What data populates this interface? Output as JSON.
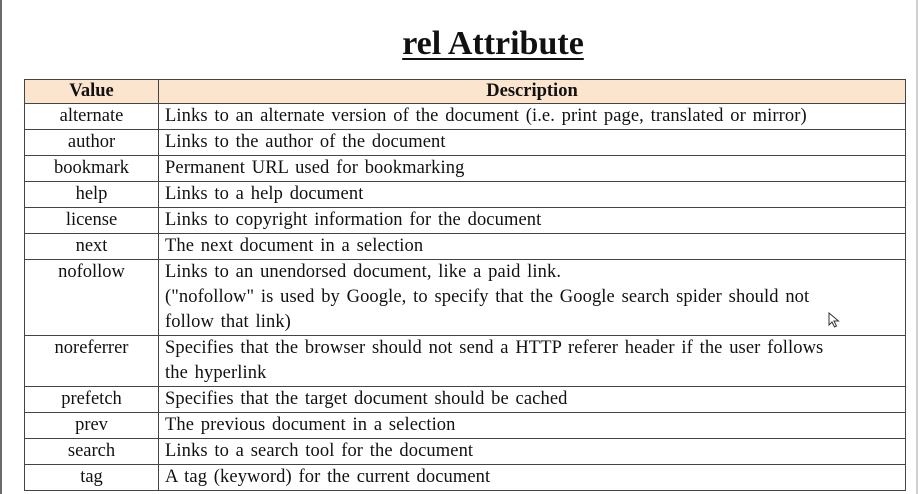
{
  "title": "rel Attribute",
  "table": {
    "headers": {
      "value": "Value",
      "description": "Description"
    },
    "rows": [
      {
        "value": "alternate",
        "description": [
          "Links to an alternate version of the document (i.e. print page, translated or mirror)"
        ]
      },
      {
        "value": "author",
        "description": [
          "Links to the author of the document"
        ]
      },
      {
        "value": "bookmark",
        "description": [
          "Permanent URL used for bookmarking"
        ]
      },
      {
        "value": "help",
        "description": [
          "Links to a help document"
        ]
      },
      {
        "value": "license",
        "description": [
          "Links to copyright information for the document"
        ]
      },
      {
        "value": "next",
        "description": [
          "The next document in a selection"
        ]
      },
      {
        "value": "nofollow",
        "description": [
          "Links to an unendorsed document, like a paid link.",
          "(\"nofollow\" is used by Google, to specify that the Google search spider should not",
          "follow that link)"
        ]
      },
      {
        "value": "noreferrer",
        "description": [
          "Specifies that the browser should not send a HTTP referer header if the user follows",
          "the hyperlink"
        ]
      },
      {
        "value": "prefetch",
        "description": [
          "Specifies that the target document should be cached"
        ]
      },
      {
        "value": "prev",
        "description": [
          "The previous document in a selection"
        ]
      },
      {
        "value": "search",
        "description": [
          "Links to a search tool for the document"
        ]
      },
      {
        "value": "tag",
        "description": [
          "A tag (keyword) for the current document"
        ]
      }
    ]
  },
  "colors": {
    "header_background": "#fbe5cf",
    "border": "#444444",
    "text": "#111111"
  },
  "icons": {
    "cursor": "mouse-pointer-icon"
  }
}
